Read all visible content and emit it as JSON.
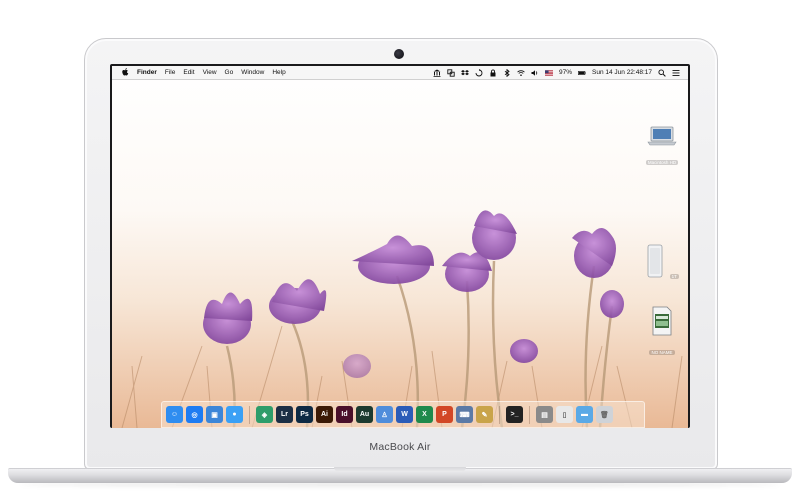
{
  "device": {
    "name": "MacBook Air"
  },
  "menubar": {
    "apple": "",
    "app_name": "Finder",
    "menus": [
      "File",
      "Edit",
      "View",
      "Go",
      "Window",
      "Help"
    ],
    "battery": "97%",
    "clock": "Sun 14 Jun  22:48:17",
    "status_icons": [
      "bank-icon",
      "dropbox-icon",
      "transfer-icon",
      "lock-icon",
      "bluetooth-icon",
      "wifi-icon",
      "volume-icon",
      "flag-icon",
      "battery-icon",
      "search-icon",
      "list-icon"
    ]
  },
  "desktop": {
    "icons": [
      {
        "name": "laptop-drive-icon",
        "label": "Macintosh HD"
      },
      {
        "name": "external-drive-icon",
        "label": "1T"
      },
      {
        "name": "sd-card-icon",
        "label": "NO NAME"
      }
    ]
  },
  "dock": {
    "apps": [
      {
        "name": "finder",
        "glyph": "☺",
        "color": "#2f8df0"
      },
      {
        "name": "safari",
        "glyph": "◎",
        "color": "#1e7cf2"
      },
      {
        "name": "preview",
        "glyph": "▣",
        "color": "#3c86d8"
      },
      {
        "name": "messages",
        "glyph": "●",
        "color": "#3aa0f5"
      },
      {
        "name": "indesign-books",
        "glyph": "◈",
        "color": "#2e9d6a"
      },
      {
        "name": "lightroom",
        "glyph": "Lr",
        "color": "#1c2f45"
      },
      {
        "name": "photoshop",
        "glyph": "Ps",
        "color": "#0d2a44"
      },
      {
        "name": "illustrator",
        "glyph": "Ai",
        "color": "#3b1a06"
      },
      {
        "name": "indesign",
        "glyph": "Id",
        "color": "#4a0f2a"
      },
      {
        "name": "audition",
        "glyph": "Au",
        "color": "#1d3a2f"
      },
      {
        "name": "keynote",
        "glyph": "♙",
        "color": "#4f8ddb"
      },
      {
        "name": "word",
        "glyph": "W",
        "color": "#2b5cb8"
      },
      {
        "name": "excel",
        "glyph": "X",
        "color": "#1f8a4c"
      },
      {
        "name": "powerpoint",
        "glyph": "P",
        "color": "#d24726"
      },
      {
        "name": "remote-desktop",
        "glyph": "⌨",
        "color": "#5b7aa6"
      },
      {
        "name": "script-editor",
        "glyph": "✎",
        "color": "#c9a44a"
      },
      {
        "name": "terminal",
        "glyph": ">_",
        "color": "#222222"
      },
      {
        "name": "scanner",
        "glyph": "▤",
        "color": "#8a8a8a"
      },
      {
        "name": "documents-stack",
        "glyph": "▯",
        "color": "#e8e8e8"
      },
      {
        "name": "downloads-folder",
        "glyph": "▬",
        "color": "#5aa9e6"
      },
      {
        "name": "trash",
        "glyph": "🗑",
        "color": "#cfd3d8"
      }
    ]
  }
}
